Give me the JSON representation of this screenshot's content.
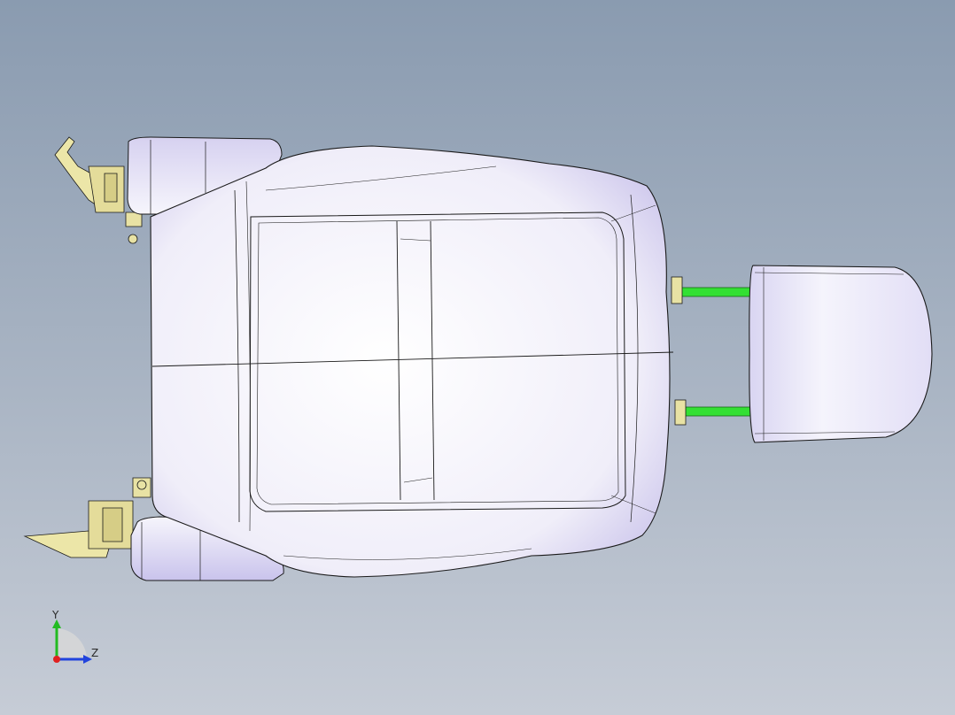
{
  "viewport": {
    "background_top": "#8a9bb0",
    "background_bottom": "#c6ccd6"
  },
  "model": {
    "body_color": "#f4f2fb",
    "shade_color": "#bdb6e2",
    "edge_color": "#1a1a1a",
    "post_color": "#33e033",
    "bracket_color": "#ece6a8",
    "components": [
      "seat-cushion",
      "side-bolster-top",
      "side-bolster-bottom",
      "headrest",
      "headrest-posts",
      "recliner-bracket-top",
      "recliner-bracket-bottom"
    ]
  },
  "triad": {
    "y_label": "Y",
    "z_label": "Z",
    "x_color": "#e02020",
    "y_color": "#22bb22",
    "z_color": "#2244dd"
  }
}
